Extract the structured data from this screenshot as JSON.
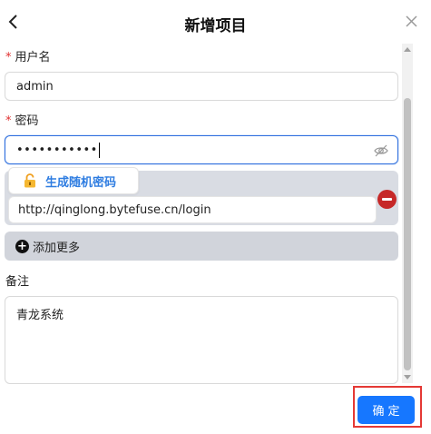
{
  "header": {
    "title": "新增项目",
    "back_icon": "chevron-left-icon",
    "close_icon": "close-icon"
  },
  "form": {
    "username": {
      "label": "用户名",
      "required": "*",
      "value": "admin"
    },
    "password": {
      "label": "密码",
      "required": "*",
      "masked_value": "•••••••••••",
      "visibility_icon": "eye-off-icon"
    },
    "generate": {
      "label": "生成随机密码",
      "icon": "unlock-icon"
    },
    "url": {
      "value": "http://qinglong.bytefuse.cn/login",
      "remove_icon": "minus-circle-icon"
    },
    "add_more": {
      "label": "添加更多",
      "icon": "plus-circle-icon"
    },
    "notes": {
      "label": "备注",
      "value": "青龙系统"
    }
  },
  "footer": {
    "confirm_label": "确定"
  },
  "colors": {
    "accent": "#1677ff",
    "link": "#2f7de1",
    "danger": "#c62828",
    "required": "#e03030",
    "highlight_frame": "#e53935"
  }
}
